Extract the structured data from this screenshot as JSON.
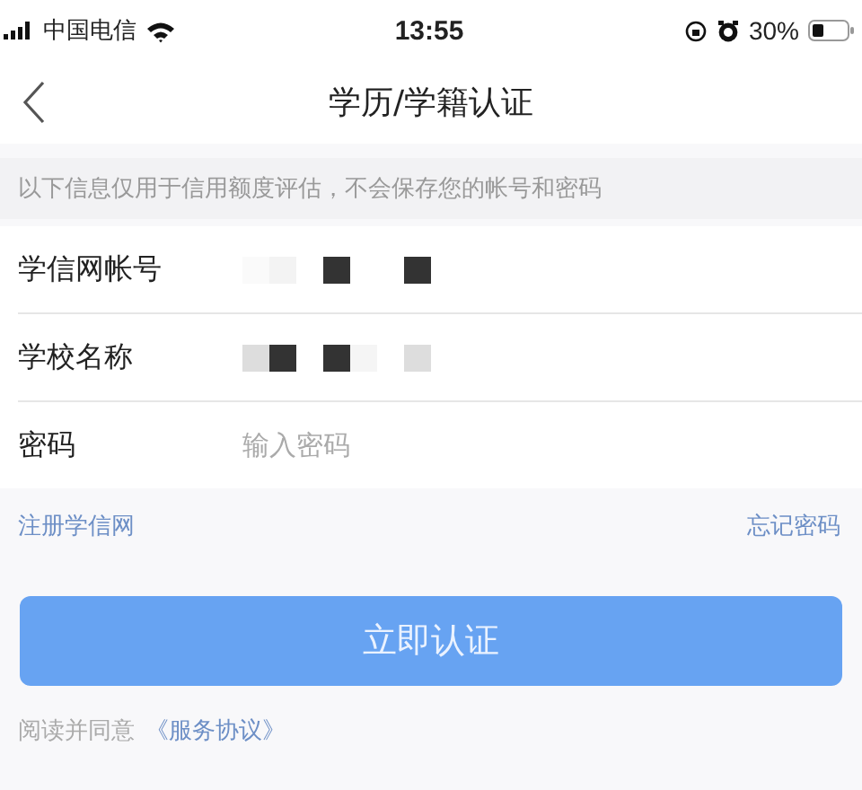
{
  "status_bar": {
    "carrier": "中国电信",
    "time": "13:55",
    "battery": "30%"
  },
  "nav": {
    "title": "学历/学籍认证"
  },
  "notice": "以下信息仅用于信用额度评估，不会保存您的帐号和密码",
  "fields": [
    {
      "label": "学信网帐号",
      "kind": "masked"
    },
    {
      "label": "学校名称",
      "kind": "masked"
    },
    {
      "label": "密码",
      "kind": "input",
      "placeholder": "输入密码"
    }
  ],
  "links": {
    "left": "注册学信网",
    "right": "忘记密码"
  },
  "submit": "立即认证",
  "agreement": {
    "text": "阅读并同意",
    "link": "《服务协议》"
  }
}
